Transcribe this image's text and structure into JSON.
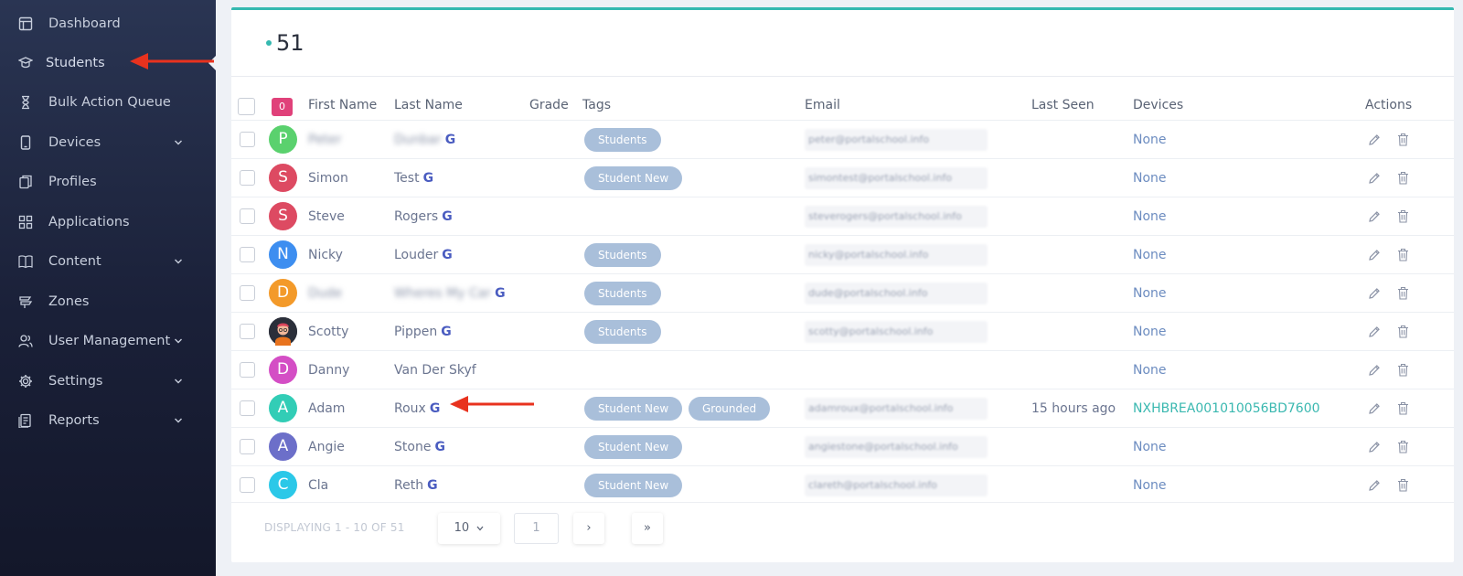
{
  "sidebar": {
    "items": [
      {
        "label": "Dashboard",
        "icon": "dashboard-icon",
        "chevron": false
      },
      {
        "label": "Students",
        "icon": "graduation-cap-icon",
        "chevron": false,
        "active": true
      },
      {
        "label": "Bulk Action Queue",
        "icon": "hourglass-icon",
        "chevron": false
      },
      {
        "label": "Devices",
        "icon": "tablet-icon",
        "chevron": true
      },
      {
        "label": "Profiles",
        "icon": "profiles-icon",
        "chevron": false
      },
      {
        "label": "Applications",
        "icon": "grid-icon",
        "chevron": false
      },
      {
        "label": "Content",
        "icon": "book-icon",
        "chevron": true
      },
      {
        "label": "Zones",
        "icon": "zones-icon",
        "chevron": false
      },
      {
        "label": "User Management",
        "icon": "users-icon",
        "chevron": true
      },
      {
        "label": "Settings",
        "icon": "gear-icon",
        "chevron": true
      },
      {
        "label": "Reports",
        "icon": "reports-icon",
        "chevron": true
      }
    ]
  },
  "summary": {
    "count": "51",
    "selected_count": "0"
  },
  "table": {
    "headers": {
      "first_name": "First Name",
      "last_name": "Last Name",
      "grade": "Grade",
      "tags": "Tags",
      "email": "Email",
      "last_seen": "Last Seen",
      "devices": "Devices",
      "actions": "Actions"
    },
    "rows": [
      {
        "initial": "P",
        "color": "#5ad16e",
        "first": "Peter",
        "last": "Dunbar",
        "blurred": true,
        "google": true,
        "tags": [
          "Students"
        ],
        "email": "peter@portalschool.info",
        "last_seen": "",
        "device": "None"
      },
      {
        "initial": "S",
        "color": "#dd4a62",
        "first": "Simon",
        "last": "Test",
        "blurred": false,
        "google": true,
        "tags": [
          "Student New"
        ],
        "email": "simontest@portalschool.info",
        "last_seen": "",
        "device": "None"
      },
      {
        "initial": "S",
        "color": "#dd4a62",
        "first": "Steve",
        "last": "Rogers",
        "blurred": false,
        "google": true,
        "tags": [],
        "email": "steverogers@portalschool.info",
        "last_seen": "",
        "device": "None"
      },
      {
        "initial": "N",
        "color": "#3d8ef0",
        "first": "Nicky",
        "last": "Louder",
        "blurred": false,
        "google": true,
        "tags": [
          "Students"
        ],
        "email": "nicky@portalschool.info",
        "last_seen": "",
        "device": "None"
      },
      {
        "initial": "D",
        "color": "#f39a2a",
        "first": "Dude",
        "last": "Wheres My Car",
        "blurred": true,
        "google": true,
        "tags": [
          "Students"
        ],
        "email": "dude@portalschool.info",
        "last_seen": "",
        "device": "None"
      },
      {
        "initial": "",
        "color": "#2b2f3a",
        "first": "Scotty",
        "last": "Pippen",
        "blurred": false,
        "google": true,
        "tags": [
          "Students"
        ],
        "email": "scotty@portalschool.info",
        "last_seen": "",
        "device": "None",
        "photo": true
      },
      {
        "initial": "D",
        "color": "#d44ec5",
        "first": "Danny",
        "last": "Van Der Skyf",
        "blurred": false,
        "google": false,
        "tags": [],
        "email": "",
        "last_seen": "",
        "device": "None"
      },
      {
        "initial": "A",
        "color": "#32cdb6",
        "first": "Adam",
        "last": "Roux",
        "blurred": false,
        "google": true,
        "tags": [
          "Student New",
          "Grounded"
        ],
        "email": "adamroux@portalschool.info",
        "last_seen": "15 hours ago",
        "device": "NXHBREA001010056BD7600",
        "device_link": true
      },
      {
        "initial": "A",
        "color": "#6c6fc9",
        "first": "Angie",
        "last": "Stone",
        "blurred": false,
        "google": true,
        "tags": [
          "Student New"
        ],
        "email": "angiestone@portalschool.info",
        "last_seen": "",
        "device": "None"
      },
      {
        "initial": "C",
        "color": "#2bc8e8",
        "first": "Cla",
        "last": "Reth",
        "blurred": false,
        "google": true,
        "tags": [
          "Student New"
        ],
        "email": "clareth@portalschool.info",
        "last_seen": "",
        "device": "None"
      }
    ]
  },
  "pagination": {
    "displaying": "DISPLAYING 1 - 10 OF 51",
    "page_size": "10",
    "page": "1",
    "next": "›",
    "last": "»"
  },
  "colors": {
    "accent": "#35b9b0",
    "tag": "#a9bfda",
    "badge": "#e0417a",
    "arrow": "#e8321e"
  }
}
